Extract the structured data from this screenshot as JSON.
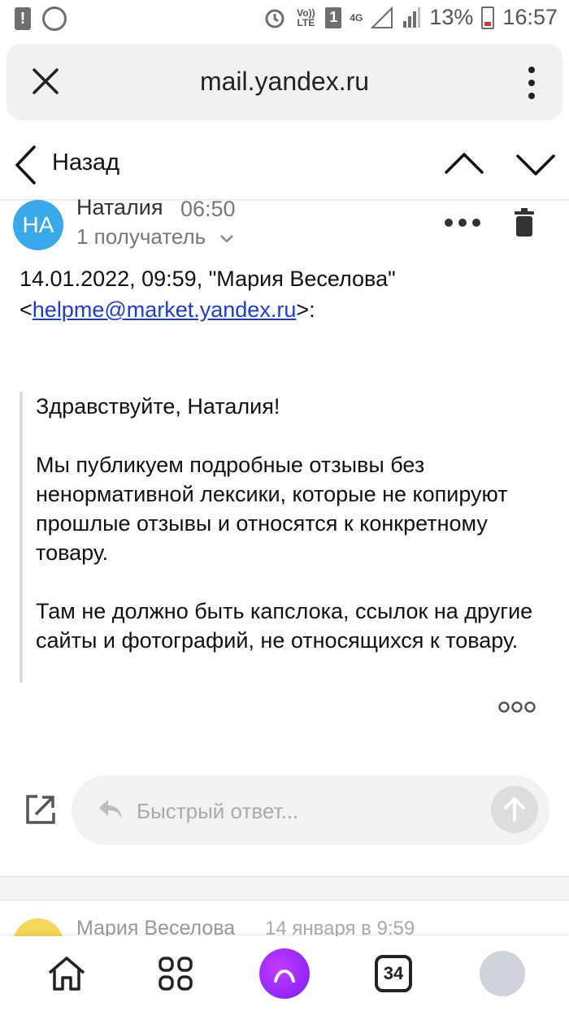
{
  "status_bar": {
    "battery": "13%",
    "time": "16:57",
    "volte": "Vo)) LTE",
    "network": "4G",
    "sim": "1"
  },
  "browser": {
    "url": "mail.yandex.ru"
  },
  "nav": {
    "back_label": "Назад"
  },
  "message": {
    "avatar_initials": "НА",
    "sender": "Наталия",
    "time": "06:50",
    "recipients": "1 получатель",
    "quote_header_line1": "14.01.2022, 09:59, \"Мария Веселова\"",
    "quote_link": "helpme@market.yandex.ru",
    "quote_header_prefix": "<",
    "quote_header_suffix": ">:",
    "paragraphs": [
      "Здравствуйте, Наталия!",
      "Мы публикуем подробные отзывы без ненормативной лексики, которые не копируют прошлые отзывы и относятся к конкретному товару.",
      "Там не должно быть капслока, ссылок на другие сайты и фотографий, не относящихся к товару."
    ]
  },
  "quick_reply": {
    "placeholder": "Быстрый ответ..."
  },
  "next_message": {
    "sender": "Мария Веселова",
    "date": "14 января в 9:59"
  },
  "bottom_bar": {
    "tabs_count": "34"
  },
  "colors": {
    "avatar": "#3aa9e9",
    "link": "#1a3fce",
    "alice": "#8a2bff"
  }
}
